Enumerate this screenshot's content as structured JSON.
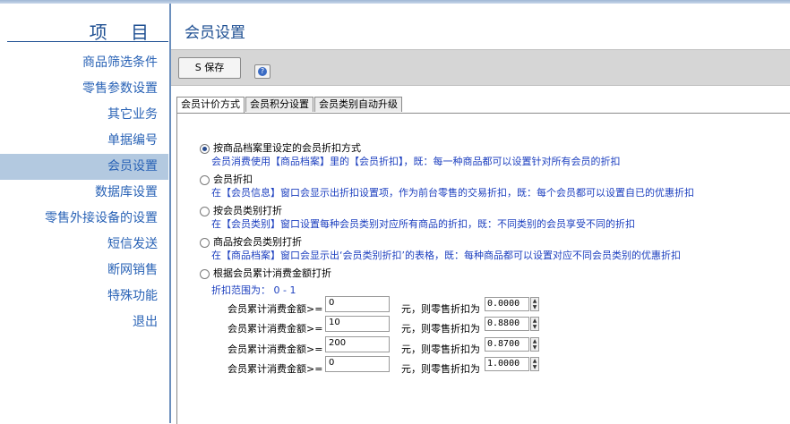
{
  "window": {
    "title_fragment": "..."
  },
  "sidebar": {
    "title": "项 目",
    "items": [
      {
        "label": "商品筛选条件",
        "active": false
      },
      {
        "label": "零售参数设置",
        "active": false
      },
      {
        "label": "其它业务",
        "active": false
      },
      {
        "label": "单据编号",
        "active": false
      },
      {
        "label": "会员设置",
        "active": true
      },
      {
        "label": "数据库设置",
        "active": false
      },
      {
        "label": "零售外接设备的设置",
        "active": false
      },
      {
        "label": "短信发送",
        "active": false
      },
      {
        "label": "断网销售",
        "active": false
      },
      {
        "label": "特殊功能",
        "active": false
      },
      {
        "label": "退出",
        "active": false
      }
    ]
  },
  "main": {
    "title": "会员设置",
    "toolbar": {
      "save_label": "S 保存",
      "help_icon": "help-icon"
    },
    "tabs": [
      {
        "label": "会员计价方式",
        "active": true
      },
      {
        "label": "会员积分设置",
        "active": false
      },
      {
        "label": "会员类别自动升级",
        "active": false
      }
    ],
    "options": [
      {
        "label": "按商品档案里设定的会员折扣方式",
        "selected": true,
        "desc": "会员消费使用【商品档案】里的【会员折扣】，既：每一种商品都可以设置针对所有会员的折扣"
      },
      {
        "label": "会员折扣",
        "selected": false,
        "desc": "在【会员信息】窗口会显示出折扣设置项，作为前台零售的交易折扣，既：每个会员都可以设置自已的优惠折扣"
      },
      {
        "label": "按会员类别打折",
        "selected": false,
        "desc": "在【会员类别】窗口设置每种会员类别对应所有商品的折扣，既：不同类别的会员享受不同的折扣"
      },
      {
        "label": "商品按会员类别打折",
        "selected": false,
        "desc": "在【商品档案】窗口会显示出‘会员类别折扣’的表格，既：每种商品都可以设置对应不同会员类别的优惠折扣"
      },
      {
        "label": "根据会员累计消费金额打折",
        "selected": false,
        "desc": ""
      }
    ],
    "range_text": "折扣范围为： 0 - 1",
    "tiers": [
      {
        "label": "会员累计消费金额>=",
        "amount": "0",
        "mid": "元，则零售折扣为",
        "discount": "0.0000"
      },
      {
        "label": "会员累计消费金额>=",
        "amount": "10",
        "mid": "元，则零售折扣为",
        "discount": "0.8800"
      },
      {
        "label": "会员累计消费金额>=",
        "amount": "200",
        "mid": "元，则零售折扣为",
        "discount": "0.8700"
      },
      {
        "label": "会员累计消费金额>=",
        "amount": "0",
        "mid": "元，则零售折扣为",
        "discount": "1.0000"
      }
    ]
  }
}
